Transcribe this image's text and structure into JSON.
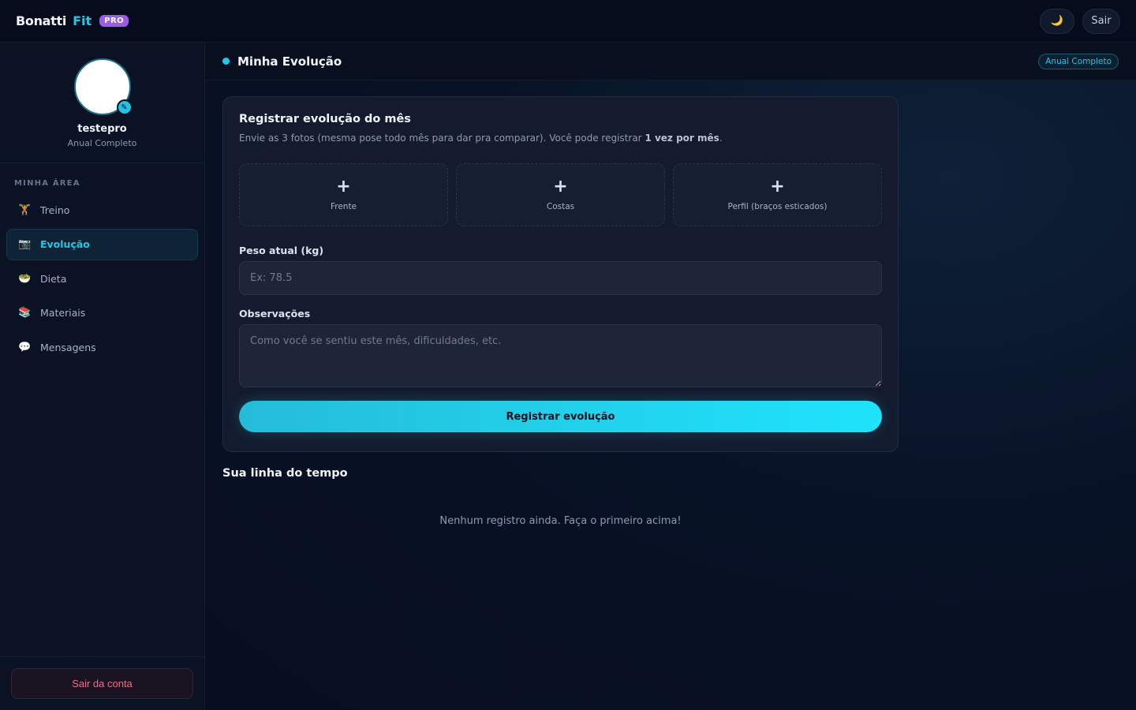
{
  "brand": {
    "name": "Bonatti",
    "accent": "Fit",
    "badge": "PRO"
  },
  "topbar": {
    "theme_icon": "🌙",
    "logout_label": "Sair"
  },
  "profile": {
    "username": "testepro",
    "plan": "Anual Completo",
    "edit_icon": "✎"
  },
  "sidebar": {
    "section_label": "MINHA ÁREA",
    "items": [
      {
        "label": "Treino",
        "icon": "🏋"
      },
      {
        "label": "Evolução",
        "icon": "📷"
      },
      {
        "label": "Dieta",
        "icon": "🥗"
      },
      {
        "label": "Materiais",
        "icon": "📚"
      },
      {
        "label": "Mensagens",
        "icon": "💬"
      }
    ],
    "active": "Evolução",
    "logout_label": "Sair da conta"
  },
  "header": {
    "title": "Minha Evolução",
    "plan_badge": "Anual Completo"
  },
  "form": {
    "title": "Registrar evolução do mês",
    "desc_prefix": "Envie as 3 fotos (mesma pose todo mês para dar pra comparar). Você pode registrar ",
    "desc_bold": "1 vez por mês",
    "desc_suffix": ".",
    "photos": [
      {
        "plus": "+",
        "label": "Frente"
      },
      {
        "plus": "+",
        "label": "Costas"
      },
      {
        "plus": "+",
        "label": "Perfil (braços esticados)"
      }
    ],
    "weight_label": "Peso atual (kg)",
    "weight_placeholder": "Ex: 78.5",
    "weight_value": "",
    "notes_label": "Observações",
    "notes_placeholder": "Como você se sentiu este mês, dificuldades, etc.",
    "notes_value": "",
    "submit_label": "Registrar evolução"
  },
  "timeline": {
    "title": "Sua linha do tempo",
    "empty_message": "Nenhum registro ainda. Faça o primeiro acima!"
  },
  "colors": {
    "accent": "#25c6e6",
    "pro_badge": "#9b5de5",
    "danger": "#f06b8a"
  }
}
